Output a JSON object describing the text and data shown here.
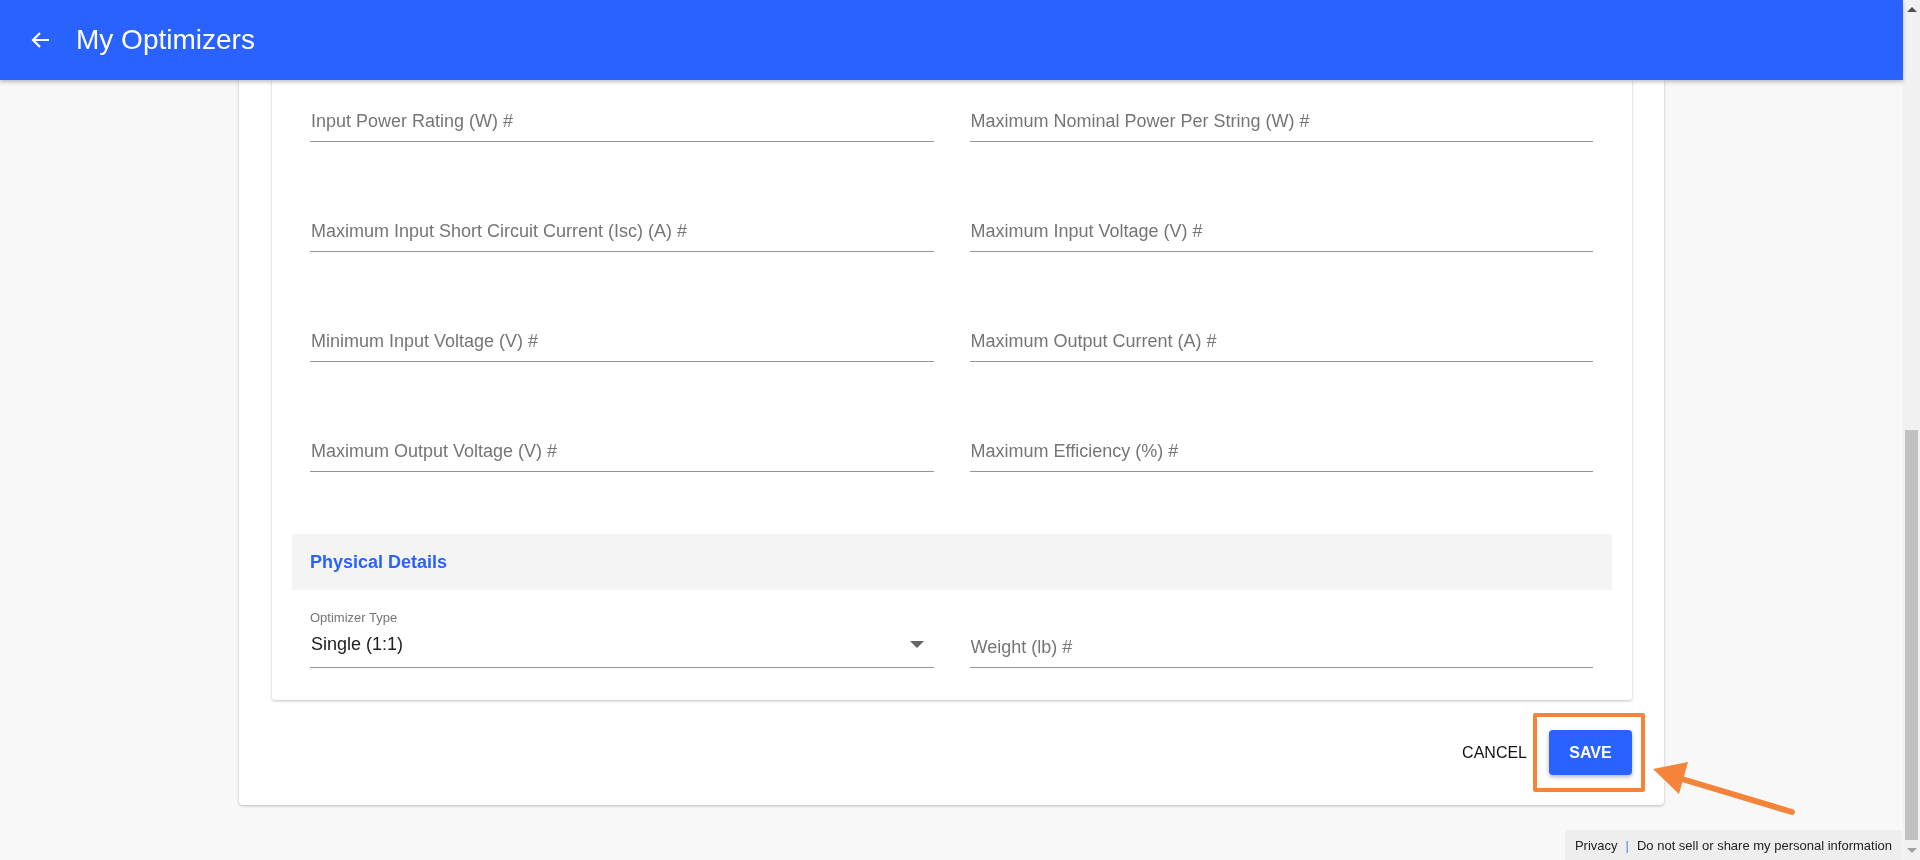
{
  "header": {
    "title": "My Optimizers"
  },
  "fields": [
    {
      "placeholder": "Input Power Rating (W) #"
    },
    {
      "placeholder": "Maximum Nominal Power Per String (W) #"
    },
    {
      "placeholder": "Maximum Input Short Circuit Current (Isc) (A) #"
    },
    {
      "placeholder": "Maximum Input Voltage (V) #"
    },
    {
      "placeholder": "Minimum Input Voltage (V) #"
    },
    {
      "placeholder": "Maximum Output Current (A) #"
    },
    {
      "placeholder": "Maximum Output Voltage (V) #"
    },
    {
      "placeholder": "Maximum Efficiency (%) #"
    }
  ],
  "physical_details": {
    "title": "Physical Details",
    "optimizer_type": {
      "label": "Optimizer Type",
      "value": "Single (1:1)"
    },
    "weight": {
      "placeholder": "Weight (lb) #"
    }
  },
  "actions": {
    "cancel": "CANCEL",
    "save": "SAVE"
  },
  "footer": {
    "privacy": "Privacy",
    "separator": "|",
    "do_not_sell": "Do not sell or share my personal information"
  }
}
